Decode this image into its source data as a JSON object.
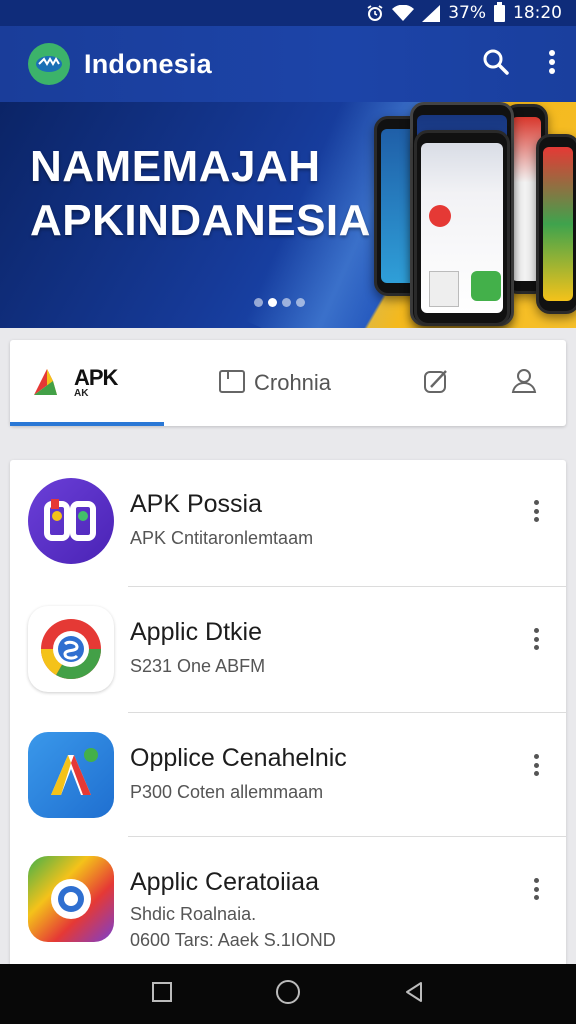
{
  "status_bar": {
    "battery_text": "37%",
    "time": "18:20"
  },
  "app_bar": {
    "title": "Indonesia",
    "icons": [
      "app-logo-icon",
      "search-icon",
      "more-vert-icon"
    ]
  },
  "banner": {
    "line1": "NAMEMAJAH",
    "line2": "APKINDANESIA",
    "page_indicator": {
      "count": 4,
      "active_index": 1
    }
  },
  "tabs": {
    "items": [
      {
        "label": "APK",
        "sublabel": "AK",
        "icon": "apk-logo-icon",
        "selected": true
      },
      {
        "label": "Crohnia",
        "icon": "folder-icon",
        "selected": false
      },
      {
        "label": "",
        "icon": "edit-icon",
        "selected": false
      },
      {
        "label": "",
        "icon": "person-icon",
        "selected": false
      }
    ]
  },
  "apps": [
    {
      "name": "APK Possia",
      "subtitle": "APK Cntitaronlemtaam",
      "subtitle2": "",
      "icon": "purple-app-icon",
      "color": "#5a34c8"
    },
    {
      "name": "Applic Dtkie",
      "subtitle": "S231 One ABFM",
      "subtitle2": "",
      "icon": "chrome-like-icon",
      "color": "#ffffff"
    },
    {
      "name": "Opplice Cenahelnic",
      "subtitle": "P300 Coten allemmaam",
      "subtitle2": "",
      "icon": "blue-a-app-icon",
      "color": "#2f87e0"
    },
    {
      "name": "Applic Ceratoiiaa",
      "subtitle": "Shdic Roalnaia.",
      "subtitle2": "0600 Tars: Aaek S.1IOND",
      "icon": "colorful-app-icon",
      "color": "#f4c21a"
    }
  ],
  "nav_bar": {
    "icons": [
      "recent-apps-icon",
      "home-icon",
      "back-icon"
    ]
  },
  "colors": {
    "app_bar": "#1c44a8",
    "tab_indicator": "#2a78d6",
    "banner_accent": "#f4b81c"
  }
}
